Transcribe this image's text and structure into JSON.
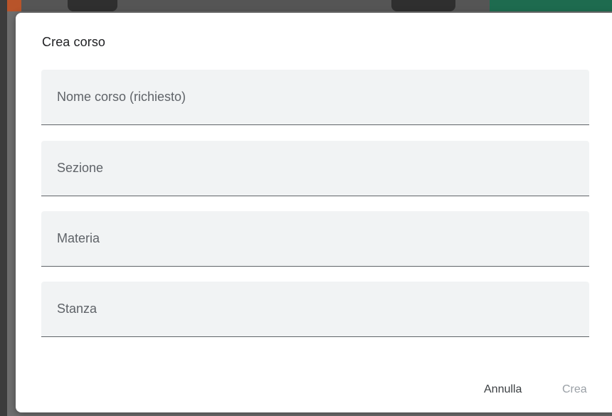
{
  "dialog": {
    "title": "Crea corso",
    "fields": [
      {
        "placeholder": "Nome corso (richiesto)",
        "value": ""
      },
      {
        "placeholder": "Sezione",
        "value": ""
      },
      {
        "placeholder": "Materia",
        "value": ""
      },
      {
        "placeholder": "Stanza",
        "value": ""
      }
    ],
    "cancel_label": "Annulla",
    "create_label": "Crea"
  },
  "colors": {
    "dialog_background": "#ffffff",
    "field_background": "#f1f3f4",
    "field_underline": "#5f6368",
    "placeholder_text": "#5f6368",
    "create_disabled_text": "#9aa0a6"
  }
}
